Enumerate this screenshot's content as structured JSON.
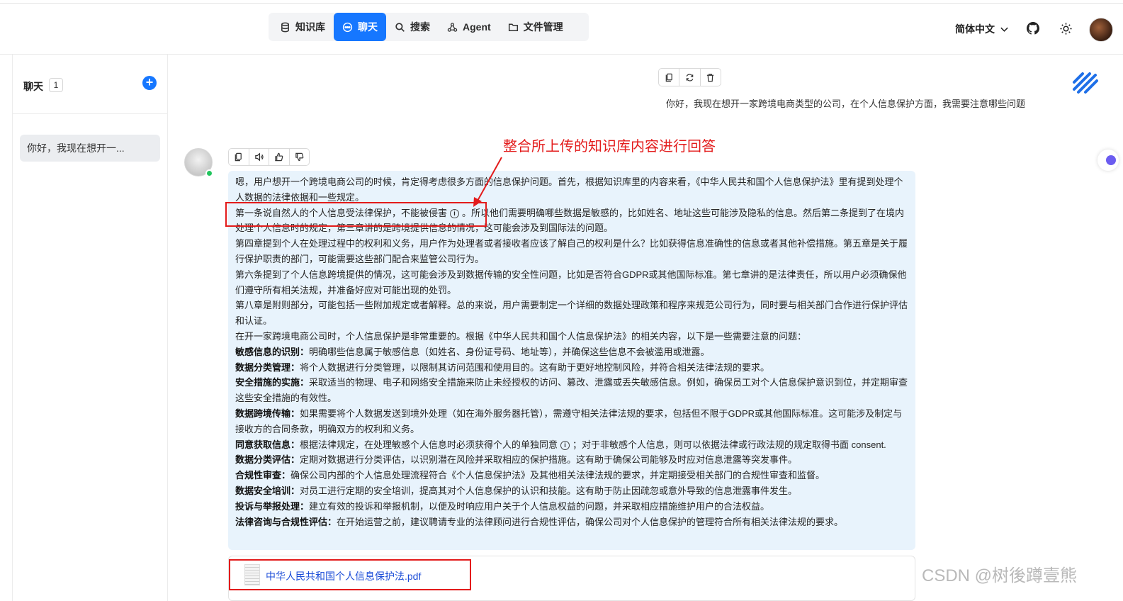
{
  "nav": {
    "items": [
      {
        "label": "知识库",
        "icon": "database-icon"
      },
      {
        "label": "聊天",
        "icon": "chat-icon",
        "active": true
      },
      {
        "label": "搜索",
        "icon": "search-icon"
      },
      {
        "label": "Agent",
        "icon": "agent-icon"
      },
      {
        "label": "文件管理",
        "icon": "folder-icon"
      }
    ],
    "language": "简体中文"
  },
  "sidebar": {
    "title": "聊天",
    "count": "1",
    "conversations": [
      {
        "label": "你好，我现在想开一..."
      }
    ]
  },
  "user_message": "你好，我现在想开一家跨境电商类型的公司，在个人信息保护方面，我需要注意哪些问题",
  "annotation": "整合所上传的知识库内容进行回答",
  "answer": {
    "p1": "嗯，用户想开一个跨境电商公司的时候，肯定得考虑很多方面的信息保护问题。首先，根据知识库里的内容来看，《中华人民共和国个人信息保护法》里有提到处理个人数据的法律依据和一些规定。",
    "p2a": "第一条说自然人的个人信息受法律保护，不能被侵害",
    "p2b": "。所以他们需要明确哪些数据是敏感的，比如姓名、地址这些可能涉及隐私的信息。然后第二条提到了在境内处理个人信息时的规定，第三章讲的是跨境提供信息的情况，这可能会涉及到国际法的问题。",
    "p3": "第四章提到个人在处理过程中的权利和义务，用户作为处理者或者接收者应该了解自己的权利是什么？比如获得信息准确性的信息或者其他补偿措施。第五章是关于履行保护职责的部门，可能需要这些部门配合来监管公司行为。",
    "p4": "第六条提到了个人信息跨境提供的情况，这可能会涉及到数据传输的安全性问题，比如是否符合GDPR或其他国际标准。第七章讲的是法律责任，所以用户必须确保他们遵守所有相关法规，并准备好应对可能出现的处罚。",
    "p5": "第八章是附则部分，可能包括一些附加规定或者解释。总的来说，用户需要制定一个详细的数据处理政策和程序来规范公司行为，同时要与相关部门合作进行保护评估和认证。",
    "p6": "在开一家跨境电商公司时，个人信息保护是非常重要的。根据《中华人民共和国个人信息保护法》的相关内容，以下是一些需要注意的问题：",
    "items": [
      {
        "title": "敏感信息的识别：",
        "text": "明确哪些信息属于敏感信息（如姓名、身份证号码、地址等），并确保这些信息不会被滥用或泄露。"
      },
      {
        "title": "数据分类管理：",
        "text": "将个人数据进行分类管理，以限制其访问范围和使用目的。这有助于更好地控制风险，并符合相关法律法规的要求。"
      },
      {
        "title": "安全措施的实施：",
        "text": "采取适当的物理、电子和网络安全措施来防止未经授权的访问、篡改、泄露或丢失敏感信息。例如，确保员工对个人信息保护意识到位，并定期审查这些安全措施的有效性。"
      },
      {
        "title": "数据跨境传输：",
        "text": "如果需要将个人数据发送到境外处理（如在海外服务器托管），需遵守相关法律法规的要求，包括但不限于GDPR或其他国际标准。这可能涉及制定与接收方的合同条款，明确双方的权利和义务。"
      },
      {
        "title": "同意获取信息：",
        "text": "根据法律规定，在处理敏感个人信息时必须获得个人的单独同意",
        "text2": "；对于非敏感个人信息，则可以依据法律或行政法规的规定取得书面 consent."
      },
      {
        "title": "数据分类评估：",
        "text": "定期对数据进行分类评估，以识别潜在风险并采取相应的保护措施。这有助于确保公司能够及时应对信息泄露等突发事件。"
      },
      {
        "title": "合规性审查：",
        "text": "确保公司内部的个人信息处理流程符合《个人信息保护法》及其他相关法律法规的要求，并定期接受相关部门的合规性审查和监督。"
      },
      {
        "title": "数据安全培训：",
        "text": "对员工进行定期的安全培训，提高其对个人信息保护的认识和技能。这有助于防止因疏忽或意外导致的信息泄露事件发生。"
      },
      {
        "title": "投诉与举报处理：",
        "text": "建立有效的投诉和举报机制，以便及时响应用户关于个人信息权益的问题，并采取相应措施维护用户的合法权益。"
      },
      {
        "title": "法律咨询与合规性评估：",
        "text": "在开始运营之前，建议聘请专业的法律顾问进行合规性评估，确保公司对个人信息保护的管理符合所有相关法律法规的要求。"
      }
    ]
  },
  "file": {
    "name": "中华人民共和国个人信息保护法.pdf"
  },
  "watermark": "CSDN @树後蹲壹熊",
  "colors": {
    "accent": "#1677ff",
    "bubble": "#e8f3fc",
    "annotation": "#e31b1b",
    "online": "#22c55e"
  }
}
